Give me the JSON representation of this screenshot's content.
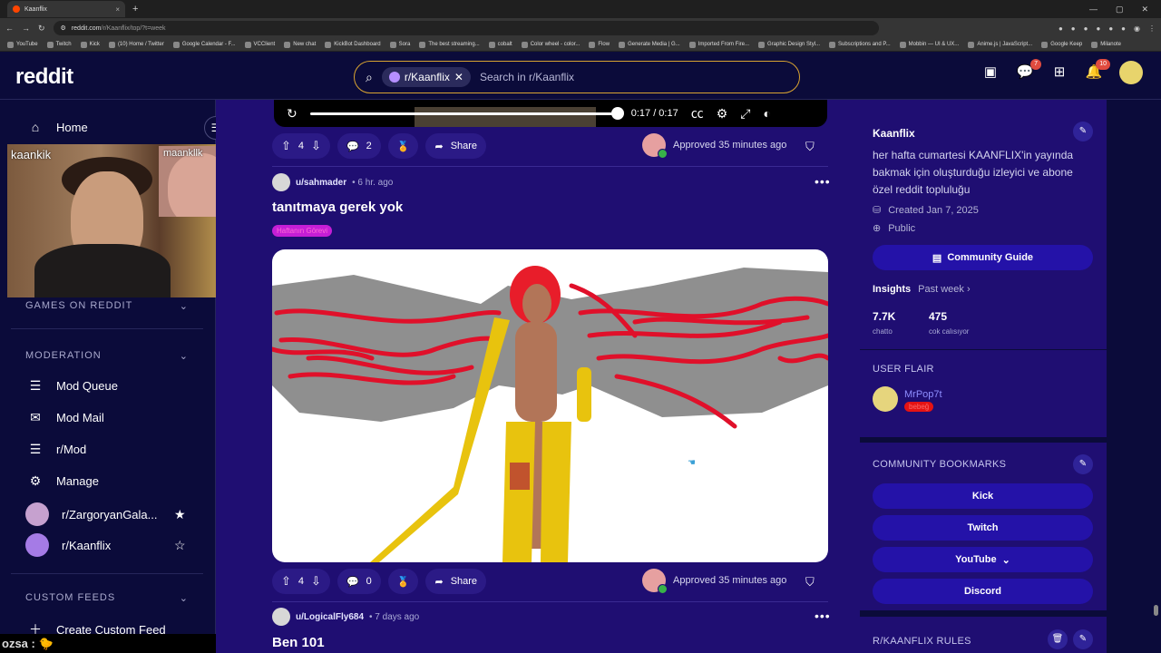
{
  "browser": {
    "tab_title": "Kaanflix",
    "tab_close": "×",
    "new_tab": "+",
    "url_host": "reddit.com",
    "url_path": "/r/Kaanflix/top/?t=week",
    "bookmarks": [
      "YouTube",
      "Twitch",
      "Kick",
      "(10) Home / Twitter",
      "Google Calendar - F...",
      "VCClient",
      "New chat",
      "KickBot Dashboard",
      "Sora",
      "The best streaming...",
      "cobalt",
      "Color wheel - color...",
      "Flow",
      "Generate Media | G...",
      "Imported From Fire...",
      "Graphic Design Styl...",
      "Subscriptions and P...",
      "Mobbin — UI & UX...",
      "Anime.js | JavaScript...",
      "Google Keep",
      "Milanote"
    ]
  },
  "header": {
    "logo": "reddit",
    "search_chip": "r/Kaanflix",
    "search_placeholder": "Search in r/Kaanflix",
    "chat_badge": "7",
    "notif_badge": "10"
  },
  "sidebar": {
    "home": "Home",
    "games_section": "GAMES ON REDDIT",
    "moderation_section": "MODERATION",
    "mod_items": [
      "Mod Queue",
      "Mod Mail",
      "r/Mod",
      "Manage"
    ],
    "communities": [
      "r/ZargoryanGala...",
      "r/Kaanflix"
    ],
    "custom_feeds_section": "CUSTOM FEEDS",
    "create_feed": "Create Custom Feed"
  },
  "webcam": {
    "main_name": "kaankik",
    "inset_name": "maankllk"
  },
  "chat_overlay": "ozsa :",
  "video": {
    "time": "0:17 / 0:17",
    "progress_fraction": 1.0
  },
  "posts": [
    {
      "upvotes": "4",
      "comments": "2",
      "share": "Share",
      "approved": "Approved 35 minutes ago"
    },
    {
      "author": "u/sahmader",
      "age": "• 6 hr. ago",
      "title": "tanıtmaya gerek yok",
      "flair": "Haftanın Görevi",
      "upvotes": "4",
      "comments": "0",
      "share": "Share",
      "approved": "Approved 35 minutes ago"
    },
    {
      "author": "u/LogicalFly684",
      "age": "• 7 days ago",
      "title": "Ben 101"
    }
  ],
  "community": {
    "name": "Kaanflix",
    "description": "her hafta cumartesi KAANFLIX'in yayında bakmak için oluşturduğu izleyici ve abone özel reddit topluluğu",
    "created": "Created Jan 7, 2025",
    "visibility": "Public",
    "guide_button": "Community Guide",
    "insights_label": "Insights",
    "insights_period": "Past week ›",
    "stats": [
      {
        "value": "7.7K",
        "label": "chatto"
      },
      {
        "value": "475",
        "label": "cok calısıyor"
      }
    ],
    "user_flair_section": "USER FLAIR",
    "flair_user": "MrPop7t",
    "flair_tag": "bebeğ",
    "bookmarks_section": "COMMUNITY BOOKMARKS",
    "bookmark_buttons": [
      "Kick",
      "Twitch",
      "YouTube",
      "Discord"
    ],
    "rules_section": "R/KAANFLIX RULES"
  },
  "colors": {
    "page_bg": "#0b0b3a",
    "feed_bg": "#1f0e72",
    "accent_button": "#2412a8",
    "search_border": "#d8a331"
  }
}
